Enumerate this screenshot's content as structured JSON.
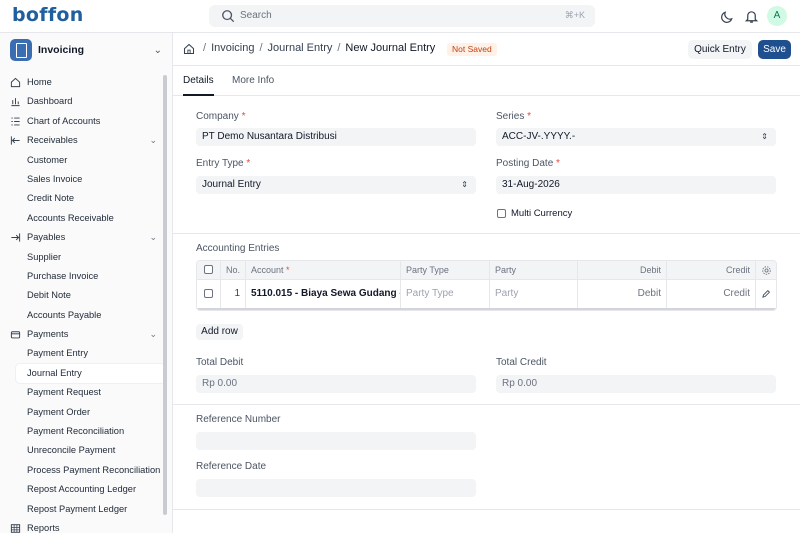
{
  "brand": {
    "logo": "boffon"
  },
  "topbar": {
    "search_placeholder": "Search",
    "search_shortcut": "⌘+K",
    "avatar_letter": "A"
  },
  "app": {
    "name": "Invoicing"
  },
  "sidebar": {
    "items": [
      {
        "label": "Home",
        "icon": "home-icon",
        "kind": "top"
      },
      {
        "label": "Dashboard",
        "icon": "bar-chart-icon",
        "kind": "top"
      },
      {
        "label": "Chart of Accounts",
        "icon": "list-icon",
        "kind": "top"
      },
      {
        "label": "Receivables",
        "icon": "arrow-in-icon",
        "kind": "group"
      },
      {
        "label": "Customer",
        "kind": "sub"
      },
      {
        "label": "Sales Invoice",
        "kind": "sub"
      },
      {
        "label": "Credit Note",
        "kind": "sub"
      },
      {
        "label": "Accounts Receivable",
        "kind": "sub"
      },
      {
        "label": "Payables",
        "icon": "arrow-out-icon",
        "kind": "group"
      },
      {
        "label": "Supplier",
        "kind": "sub"
      },
      {
        "label": "Purchase Invoice",
        "kind": "sub"
      },
      {
        "label": "Debit Note",
        "kind": "sub"
      },
      {
        "label": "Accounts Payable",
        "kind": "sub"
      },
      {
        "label": "Payments",
        "icon": "payments-icon",
        "kind": "group"
      },
      {
        "label": "Payment Entry",
        "kind": "sub"
      },
      {
        "label": "Journal Entry",
        "kind": "sub",
        "active": true
      },
      {
        "label": "Payment Request",
        "kind": "sub"
      },
      {
        "label": "Payment Order",
        "kind": "sub"
      },
      {
        "label": "Payment Reconciliation",
        "kind": "sub"
      },
      {
        "label": "Unreconcile Payment",
        "kind": "sub"
      },
      {
        "label": "Process Payment Reconciliation",
        "kind": "sub"
      },
      {
        "label": "Repost Accounting Ledger",
        "kind": "sub"
      },
      {
        "label": "Repost Payment Ledger",
        "kind": "sub"
      },
      {
        "label": "Reports",
        "icon": "table-icon",
        "kind": "top"
      }
    ]
  },
  "header": {
    "breadcrumbs": [
      "Invoicing",
      "Journal Entry"
    ],
    "title": "New Journal Entry",
    "status": "Not Saved",
    "quick_entry": "Quick Entry",
    "save": "Save"
  },
  "tabs": [
    "Details",
    "More Info"
  ],
  "form": {
    "company_label": "Company",
    "company_value": "PT Demo Nusantara Distribusi",
    "series_label": "Series",
    "series_value": "ACC-JV-.YYYY.-",
    "entry_type_label": "Entry Type",
    "entry_type_value": "Journal Entry",
    "posting_date_label": "Posting Date",
    "posting_date_value": "31-Aug-2026",
    "multi_currency_label": "Multi Currency",
    "required_mark": "*",
    "accounting_entries_label": "Accounting Entries",
    "table": {
      "headers": {
        "no": "No.",
        "account": "Account",
        "party_type": "Party Type",
        "party": "Party",
        "debit": "Debit",
        "credit": "Credit"
      },
      "rows": [
        {
          "no": "1",
          "account": "5110.015 - Biaya Sewa Gudang -",
          "party_type": "Party Type",
          "party": "Party",
          "debit": "Debit",
          "credit": "Credit"
        }
      ]
    },
    "add_row": "Add row",
    "total_debit_label": "Total Debit",
    "total_debit_value": "Rp 0.00",
    "total_credit_label": "Total Credit",
    "total_credit_value": "Rp 0.00",
    "reference_number_label": "Reference Number",
    "reference_date_label": "Reference Date"
  }
}
